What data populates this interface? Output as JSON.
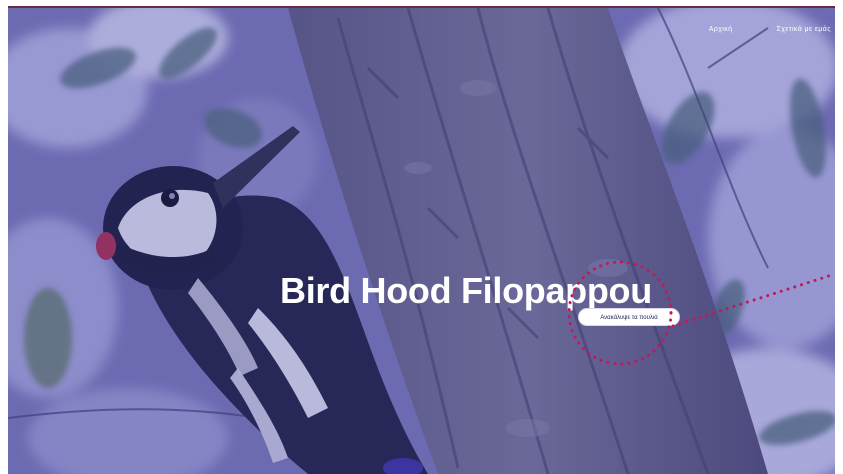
{
  "nav": {
    "items": [
      {
        "label": "Αρχική"
      },
      {
        "label": "Σχετικά με εμάς"
      }
    ]
  },
  "hero": {
    "title": "Bird Hood Filopappou",
    "cta_label": "Ανακάλυψε τα πουλιά"
  },
  "colors": {
    "overlay": "#4646a0",
    "callout": "#c2185b",
    "cta_text": "#1e2150"
  }
}
